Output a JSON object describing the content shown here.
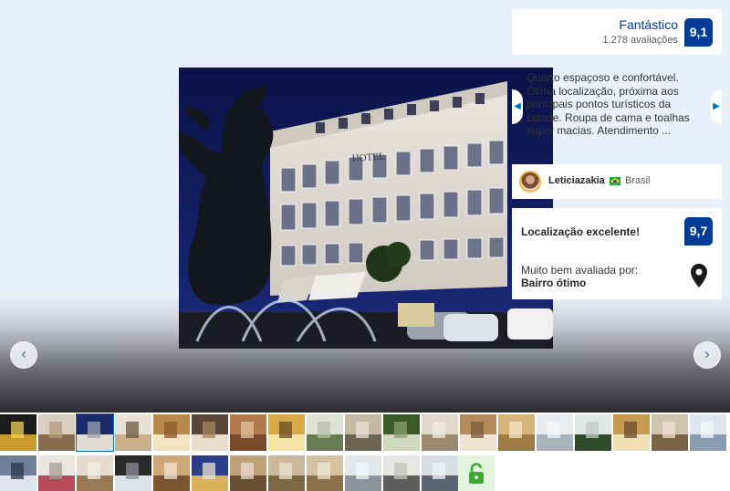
{
  "colors": {
    "brand_blue": "#003b95",
    "link_blue": "#0071c2",
    "background": "#eaf0fb"
  },
  "score": {
    "label": "Fantástico",
    "reviews_count": "1.278 avaliações",
    "value": "9,1"
  },
  "review": {
    "text": "Quarto espaçoso e confortável. Ótima localização, próxima aos principais pontos turísticos da cidade. Roupa de cama e toalhas super macias. Atendimento ...",
    "reviewer_name": "Leticiazakia",
    "reviewer_country": "Brasil"
  },
  "location": {
    "title": "Localização excelente!",
    "value": "9,7",
    "subtitle": "Muito bem avaliada por:",
    "highlight": "Bairro ótimo"
  },
  "icons": {
    "prev": "chevron-left-icon",
    "next": "chevron-right-icon",
    "pin": "map-pin-icon",
    "lock": "unlock-icon"
  },
  "main_photo": {
    "sign_text": "HOTEL"
  },
  "thumbnails": {
    "row1_count": 19,
    "row2_count": 12,
    "selected_index": 2
  }
}
